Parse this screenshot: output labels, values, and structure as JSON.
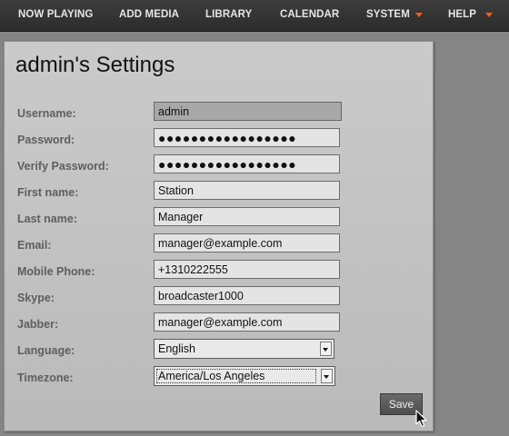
{
  "nav": {
    "items": [
      {
        "label": "NOW PLAYING"
      },
      {
        "label": "ADD MEDIA"
      },
      {
        "label": "LIBRARY"
      },
      {
        "label": "CALENDAR"
      },
      {
        "label": "SYSTEM",
        "has_dropdown": true
      },
      {
        "label": "HELP",
        "has_dropdown": true
      }
    ],
    "arrow_color": "#ff5d1a"
  },
  "page": {
    "title": "admin's Settings"
  },
  "form": {
    "username": {
      "label": "Username:",
      "value": "admin"
    },
    "password": {
      "label": "Password:",
      "value": "●●●●●●●●●●●●●●●●●"
    },
    "verify_password": {
      "label": "Verify Password:",
      "value": "●●●●●●●●●●●●●●●●●"
    },
    "first_name": {
      "label": "First name:",
      "value": "Station"
    },
    "last_name": {
      "label": "Last name:",
      "value": "Manager"
    },
    "email": {
      "label": "Email:",
      "value": "manager@example.com"
    },
    "mobile_phone": {
      "label": "Mobile Phone:",
      "value": "+1310222555"
    },
    "skype": {
      "label": "Skype:",
      "value": "broadcaster1000"
    },
    "jabber": {
      "label": "Jabber:",
      "value": "manager@example.com"
    },
    "language": {
      "label": "Language:",
      "value": "English"
    },
    "timezone": {
      "label": "Timezone:",
      "value": "America/Los Angeles"
    },
    "save_label": "Save"
  },
  "icons": {
    "dropdown": "chevron-down-icon",
    "cursor": "mouse-pointer-icon"
  }
}
